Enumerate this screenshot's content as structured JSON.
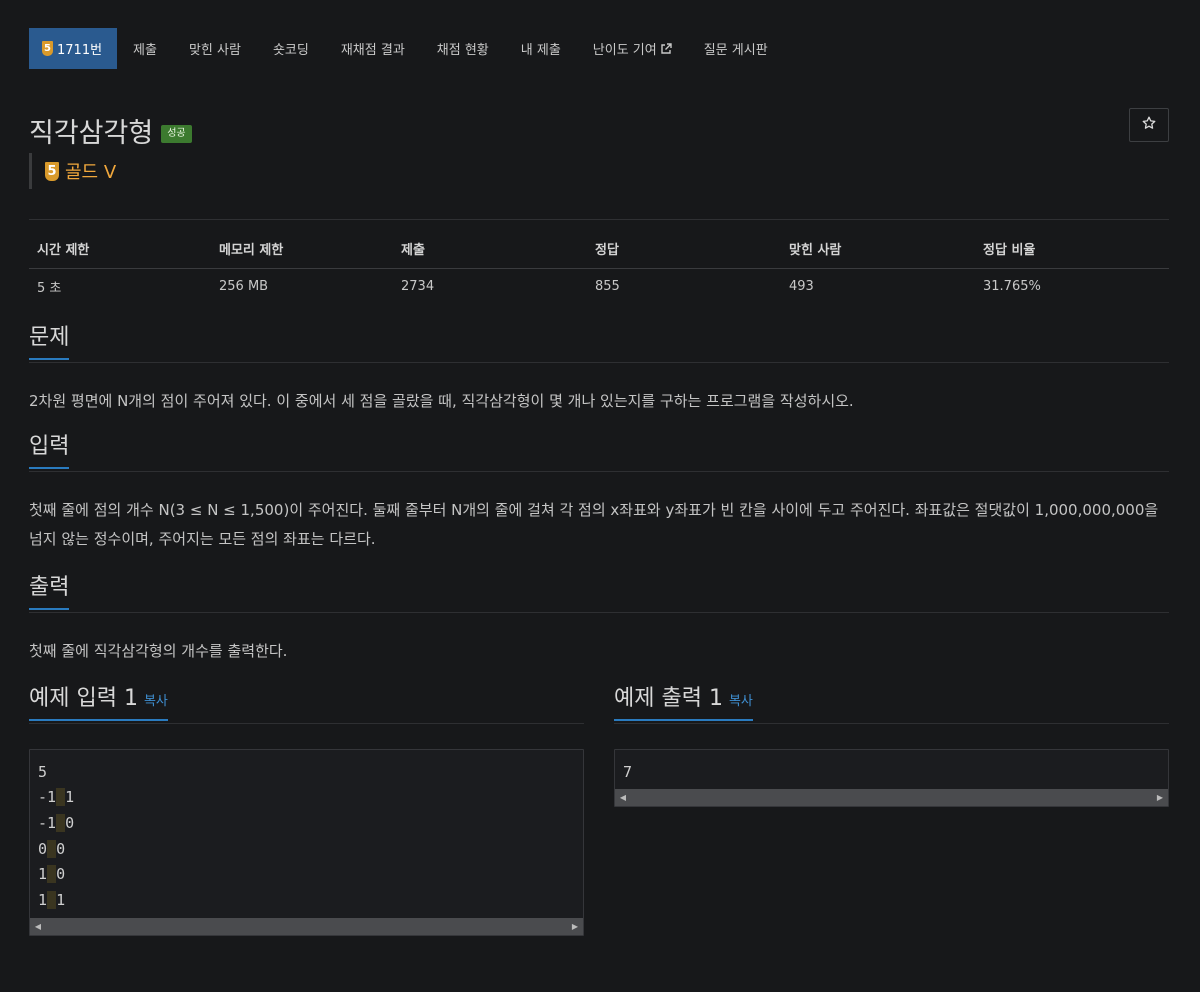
{
  "nav": {
    "problem_id": "1711번",
    "tier_number": "5",
    "items": [
      "제출",
      "맞힌 사람",
      "숏코딩",
      "재채점 결과",
      "채점 현황",
      "내 제출",
      "난이도 기여",
      "질문 게시판"
    ]
  },
  "problem": {
    "title": "직각삼각형",
    "status": "성공",
    "tier_number": "5",
    "tier_label": "골드 V"
  },
  "info": {
    "headers": [
      "시간 제한",
      "메모리 제한",
      "제출",
      "정답",
      "맞힌 사람",
      "정답 비율"
    ],
    "values": [
      "5 초",
      "256 MB",
      "2734",
      "855",
      "493",
      "31.765%"
    ]
  },
  "sections": {
    "problem_title": "문제",
    "problem_text": "2차원 평면에 N개의 점이 주어져 있다. 이 중에서 세 점을 골랐을 때, 직각삼각형이 몇 개나 있는지를 구하는 프로그램을 작성하시오.",
    "input_title": "입력",
    "input_text": "첫째 줄에 점의 개수 N(3 ≤ N ≤ 1,500)이 주어진다. 둘째 줄부터 N개의 줄에 걸쳐 각 점의 x좌표와 y좌표가 빈 칸을 사이에 두고 주어진다. 좌표값은 절댓값이 1,000,000,000을 넘지 않는 정수이며, 주어지는 모든 점의 좌표는 다르다.",
    "output_title": "출력",
    "output_text": "첫째 줄에 직각삼각형의 개수를 출력한다."
  },
  "samples": {
    "input_title": "예제 입력 1",
    "output_title": "예제 출력 1",
    "copy_label": "복사",
    "input_lines": [
      [
        "5"
      ],
      [
        "-1",
        "1"
      ],
      [
        "-1",
        "0"
      ],
      [
        "0",
        "0"
      ],
      [
        "1",
        "0"
      ],
      [
        "1",
        "1"
      ]
    ],
    "output_text": "7"
  },
  "colors": {
    "background": "#17181a",
    "nav_active": "#2a5a8f",
    "tier_gold": "#f0a73c",
    "success_badge": "#3c7a2f",
    "section_underline": "#2a7bbf",
    "link": "#3f8fd2"
  },
  "icons": [
    "external-link-icon",
    "star-icon",
    "tier-gold-5-icon"
  ]
}
